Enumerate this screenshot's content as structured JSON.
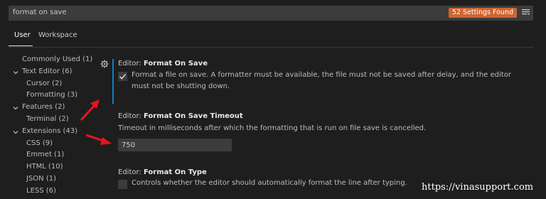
{
  "search": {
    "value": "format on save",
    "results_badge": "52 Settings Found"
  },
  "tabs": [
    {
      "label": "User"
    },
    {
      "label": "Workspace"
    }
  ],
  "toc": [
    {
      "label": "Commonly Used (1)"
    },
    {
      "label": "Text Editor (6)"
    },
    {
      "label": "Cursor (2)"
    },
    {
      "label": "Formatting (3)"
    },
    {
      "label": "Features (2)"
    },
    {
      "label": "Terminal (2)"
    },
    {
      "label": "Extensions (43)"
    },
    {
      "label": "CSS (9)"
    },
    {
      "label": "Emmet (1)"
    },
    {
      "label": "HTML (10)"
    },
    {
      "label": "JSON (1)"
    },
    {
      "label": "LESS (6)"
    }
  ],
  "settings": [
    {
      "category": "Editor: ",
      "name": "Format On Save",
      "description": "Format a file on save. A formatter must be available, the file must not be saved after delay, and the editor must not be shutting down.",
      "checked": true
    },
    {
      "category": "Editor: ",
      "name": "Format On Save Timeout",
      "description": "Timeout in milliseconds after which the formatting that is run on file save is cancelled.",
      "value": "750"
    },
    {
      "category": "Editor: ",
      "name": "Format On Type",
      "description": "Controls whether the editor should automatically format the line after typing.",
      "checked": false
    }
  ],
  "watermark": "https://vinasupport.com",
  "colors": {
    "accent_orange": "#cc6633",
    "focus_blue": "#0e7fc8",
    "arrow_red": "#e8141c"
  }
}
